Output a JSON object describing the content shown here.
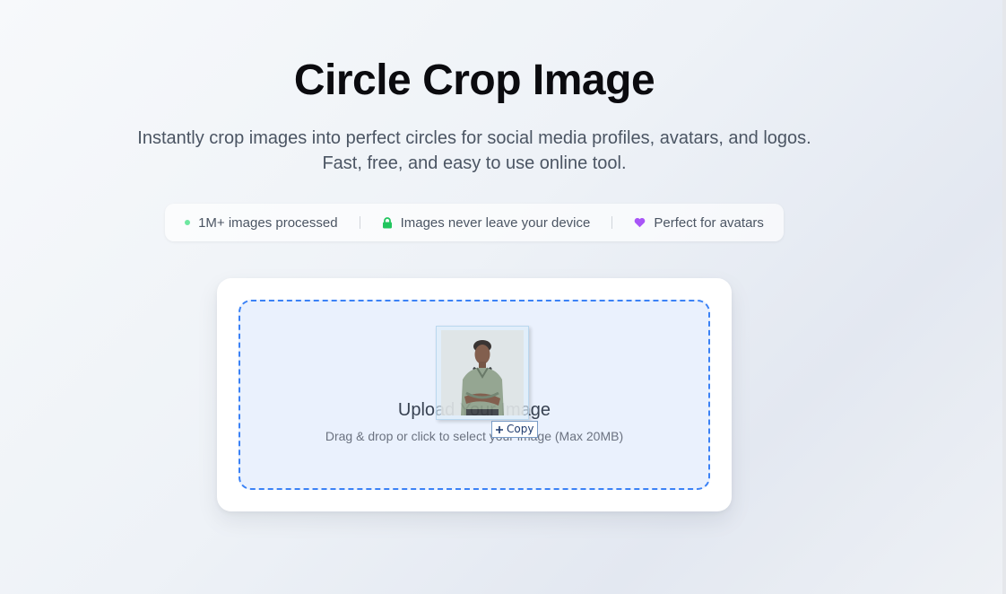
{
  "header": {
    "title": "Circle Crop Image",
    "subtitle": "Instantly crop images into perfect circles for social media profiles, avatars, and logos. Fast, free, and easy to use online tool."
  },
  "stats": [
    {
      "icon": "green-dot-icon",
      "label": "1M+ images processed"
    },
    {
      "icon": "lock-icon",
      "label": "Images never leave your device"
    },
    {
      "icon": "heart-icon",
      "label": "Perfect for avatars"
    }
  ],
  "upload": {
    "title": "Upload Your Image",
    "hint": "Drag & drop or click to select your image (Max 20MB)"
  },
  "drag_overlay": {
    "copy_label": "Copy"
  },
  "colors": {
    "accent": "#3b82f6",
    "dropzone_bg": "#eaf1fd",
    "dot_green": "#6ee7a0",
    "lock_green": "#22c55e",
    "heart_purple": "#a855f7"
  }
}
